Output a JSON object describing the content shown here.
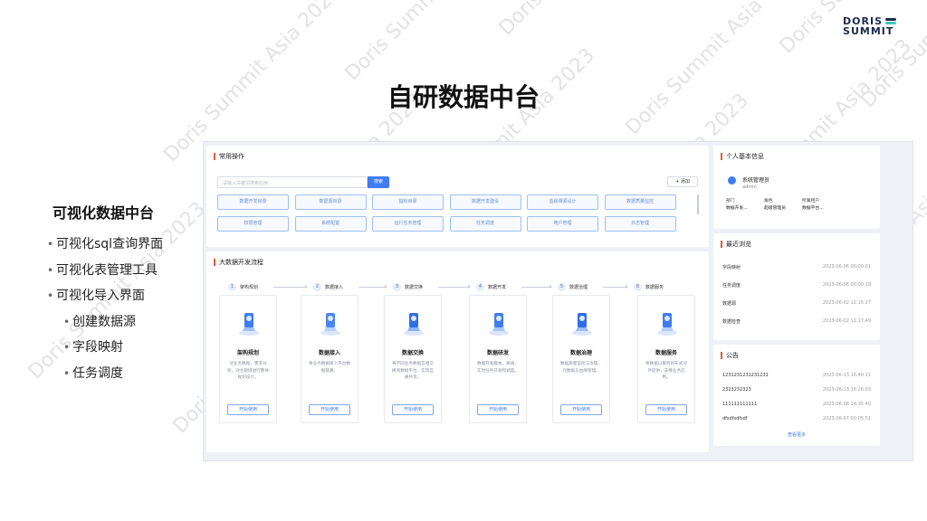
{
  "slide": {
    "title": "自研数据中台",
    "logo_line1": "DORIS",
    "logo_line2": "SUMMIT",
    "watermark_text": "Doris Summit Asia 2023"
  },
  "left": {
    "heading": "可视化数据中台",
    "bullets": [
      {
        "text": "可视化sql查询界面",
        "level": 1
      },
      {
        "text": "可视化表管理工具",
        "level": 1
      },
      {
        "text": "可视化导入界面",
        "level": 1
      },
      {
        "text": "创建数据源",
        "level": 2
      },
      {
        "text": "字段映射",
        "level": 2
      },
      {
        "text": "任务调度",
        "level": 2
      }
    ]
  },
  "app": {
    "quick": {
      "title": "常用操作",
      "search_placeholder": "请输入关键词搜索应用",
      "search_button": "搜索",
      "add_button": "+ 添加",
      "buttons": [
        "数据开发目录",
        "数据源目录",
        "指标目录",
        "数据开发建设",
        "血缘溯源设计",
        "数据质量监控",
        "权限管理",
        "系统配置",
        "运行任务管理",
        "任务调度",
        "用户管理",
        "日志管理"
      ]
    },
    "flow": {
      "title": "大数据开发流程",
      "steps": [
        "架构规划",
        "数据接入",
        "数据交换",
        "数据开发",
        "数据治理",
        "数据服务"
      ],
      "cards": [
        {
          "title": "架构规划",
          "desc": "对业务数据，需求分析，对主题域进行整体规划设计。",
          "button": "开始使用"
        },
        {
          "title": "数据接入",
          "desc": "将业务数据接入平台数据链路。",
          "button": "开始使用"
        },
        {
          "title": "数据交换",
          "desc": "将不同业务数据互相交换到数据平台，实现互通共享。",
          "button": "开始使用"
        },
        {
          "title": "数据研发",
          "desc": "数据开发脚本，离线、实时任务开发和调度。",
          "button": "开始使用"
        },
        {
          "title": "数据治理",
          "desc": "数据质量监控与治理，元数据与血缘管理。",
          "button": "开始使用"
        },
        {
          "title": "数据服务",
          "desc": "将数据以服务的形式对外提供，支撑业务应用。",
          "button": "开始使用"
        }
      ]
    },
    "profile": {
      "title": "个人基本信息",
      "name": "系统管理员",
      "user": "admin",
      "fields": [
        {
          "label": "部门",
          "value": "数据开发..."
        },
        {
          "label": "角色",
          "value": "超级管理员"
        },
        {
          "label": "所属租户",
          "value": "数据平台..."
        }
      ]
    },
    "recent": {
      "title": "最近浏览",
      "rows": [
        {
          "name": "字段映射",
          "date": "2023-06-06 00:00:01"
        },
        {
          "name": "任务调度",
          "date": "2023-06-06 00:00:19"
        },
        {
          "name": "数据源",
          "date": "2023-06-02 11:15:27"
        },
        {
          "name": "数据检查",
          "date": "2023-06-02 11:17:49"
        }
      ]
    },
    "notice": {
      "title": "公告",
      "rows": [
        {
          "name": "1231231231231231",
          "date": "2023-06-13 16:40:11"
        },
        {
          "name": "2323232323",
          "date": "2023-06-13 16:26:03"
        },
        {
          "name": "111111111111",
          "date": "2023-06-08 14:35:40"
        },
        {
          "name": "dfsdfsdfsdf",
          "date": "2023-06-07 00:05:51"
        }
      ],
      "more": "查看更多"
    }
  }
}
